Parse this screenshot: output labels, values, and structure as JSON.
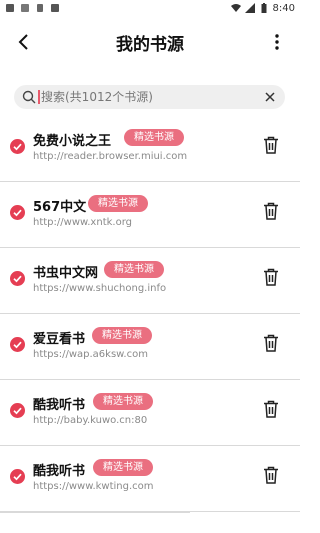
{
  "status": {
    "time": "8:40"
  },
  "header": {
    "title": "我的书源"
  },
  "search": {
    "placeholder": "搜索(共1012个书源)"
  },
  "sources": [
    {
      "name": "免费小说之王",
      "badge": "精选书源",
      "url": "http://reader.browser.miui.com"
    },
    {
      "name": "567中文",
      "badge": "精选书源",
      "url": "http://www.xntk.org"
    },
    {
      "name": "书虫中文网",
      "badge": "精选书源",
      "url": "https://www.shuchong.info"
    },
    {
      "name": "爱豆看书",
      "badge": "精选书源",
      "url": "https://wap.a6ksw.com"
    },
    {
      "name": "酷我听书",
      "badge": "精选书源",
      "url": "http://baby.kuwo.cn:80"
    },
    {
      "name": "酷我听书",
      "badge": "精选书源",
      "url": "https://www.kwting.com"
    }
  ],
  "colors": {
    "accent": "#e53e53",
    "badge": "#ea6f80"
  },
  "icons": {
    "back": "back-arrow-icon",
    "more": "more-vertical-icon",
    "search": "search-icon",
    "clear": "close-icon",
    "check": "check-circle-icon",
    "delete": "trash-icon"
  }
}
